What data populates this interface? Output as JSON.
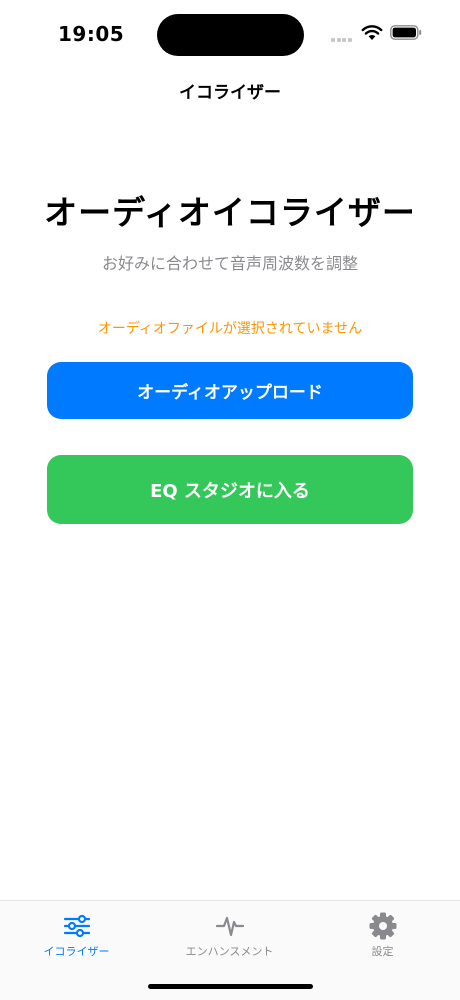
{
  "status_bar": {
    "time": "19:05"
  },
  "navigation": {
    "title": "イコライザー"
  },
  "hero": {
    "title": "オーディオイコライザー",
    "subtitle": "お好みに合わせて音声周波数を調整"
  },
  "status_message": "オーディオファイルが選択されていません",
  "buttons": {
    "upload_label": "オーディオアップロード",
    "eq_studio_label": "EQ スタジオに入る"
  },
  "tab_bar": {
    "items": [
      {
        "label": "イコライザー",
        "icon": "sliders-icon",
        "active": true
      },
      {
        "label": "エンハンスメント",
        "icon": "waveform-icon",
        "active": false
      },
      {
        "label": "設定",
        "icon": "gear-icon",
        "active": false
      }
    ]
  },
  "colors": {
    "accent": "#007aff",
    "upload_button": "#007aff",
    "eq_button": "#34c759",
    "warning_text": "#ff9500",
    "secondary_text": "#8a8a8e"
  }
}
